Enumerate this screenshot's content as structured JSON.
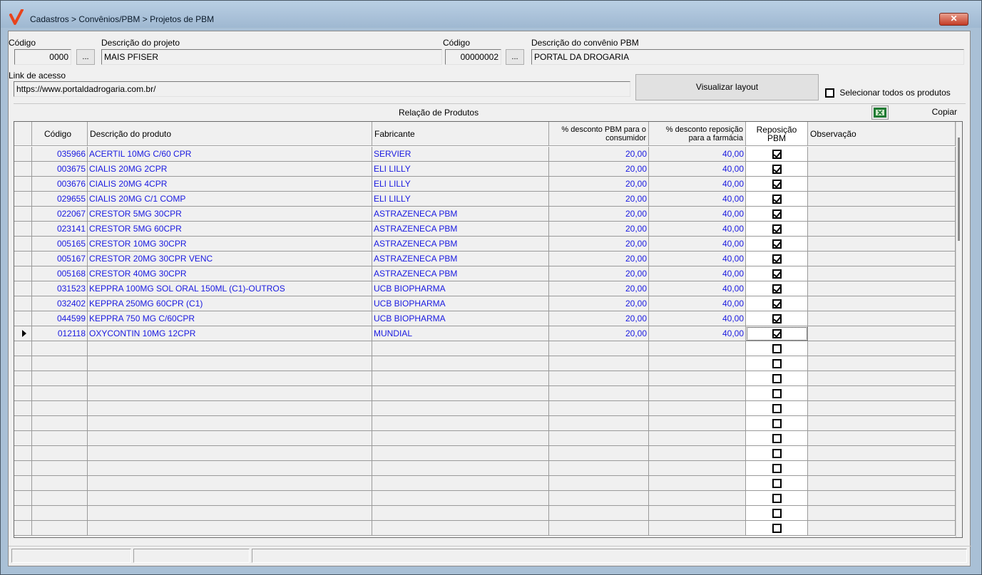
{
  "window": {
    "title": "Cadastros > Convênios/PBM > Projetos de PBM",
    "close_label": "✕"
  },
  "form": {
    "codigo_label": "Código",
    "codigo_value": "0000",
    "descricao_projeto_label": "Descrição do projeto",
    "descricao_projeto_value": "MAIS PFISER",
    "codigo_convenio_label": "Código",
    "codigo_convenio_value": "00000002",
    "descricao_convenio_label": "Descrição do convênio PBM",
    "descricao_convenio_value": "PORTAL DA DROGARIA",
    "ellipsis_label": "...",
    "link_label": "Link de acesso",
    "link_value": "https://www.portaldadrogaria.com.br/",
    "visualizar_layout_label": "Visualizar layout",
    "selecionar_todos_label": "Selecionar todos os produtos",
    "selecionar_todos_checked": false
  },
  "section": {
    "title": "Relação de Produtos",
    "copiar_label": "Copiar",
    "excel_icon": "excel-export-icon"
  },
  "table": {
    "headers": {
      "codigo": "Código",
      "descricao": "Descrição do produto",
      "fabricante": "Fabricante",
      "desconto_pbm": "% desconto PBM para o consumidor",
      "desconto_reposicao": "% desconto reposição para a farmácia",
      "reposicao_pbm": "Reposição PBM",
      "observacao": "Observação"
    },
    "rows": [
      {
        "codigo": "035966",
        "descricao": "ACERTIL 10MG C/60 CPR",
        "fabricante": "SERVIER",
        "desc_pbm": "20,00",
        "desc_rep": "40,00",
        "reposicao": true,
        "obs": ""
      },
      {
        "codigo": "003675",
        "descricao": "CIALIS 20MG 2CPR",
        "fabricante": "ELI LILLY",
        "desc_pbm": "20,00",
        "desc_rep": "40,00",
        "reposicao": true,
        "obs": ""
      },
      {
        "codigo": "003676",
        "descricao": "CIALIS 20MG 4CPR",
        "fabricante": "ELI LILLY",
        "desc_pbm": "20,00",
        "desc_rep": "40,00",
        "reposicao": true,
        "obs": ""
      },
      {
        "codigo": "029655",
        "descricao": "CIALIS 20MG C/1 COMP",
        "fabricante": "ELI LILLY",
        "desc_pbm": "20,00",
        "desc_rep": "40,00",
        "reposicao": true,
        "obs": ""
      },
      {
        "codigo": "022067",
        "descricao": "CRESTOR  5MG 30CPR",
        "fabricante": "ASTRAZENECA PBM",
        "desc_pbm": "20,00",
        "desc_rep": "40,00",
        "reposicao": true,
        "obs": ""
      },
      {
        "codigo": "023141",
        "descricao": "CRESTOR  5MG 60CPR",
        "fabricante": "ASTRAZENECA PBM",
        "desc_pbm": "20,00",
        "desc_rep": "40,00",
        "reposicao": true,
        "obs": ""
      },
      {
        "codigo": "005165",
        "descricao": "CRESTOR 10MG 30CPR",
        "fabricante": "ASTRAZENECA PBM",
        "desc_pbm": "20,00",
        "desc_rep": "40,00",
        "reposicao": true,
        "obs": ""
      },
      {
        "codigo": "005167",
        "descricao": "CRESTOR 20MG 30CPR VENC",
        "fabricante": "ASTRAZENECA PBM",
        "desc_pbm": "20,00",
        "desc_rep": "40,00",
        "reposicao": true,
        "obs": ""
      },
      {
        "codigo": "005168",
        "descricao": "CRESTOR 40MG 30CPR",
        "fabricante": "ASTRAZENECA PBM",
        "desc_pbm": "20,00",
        "desc_rep": "40,00",
        "reposicao": true,
        "obs": ""
      },
      {
        "codigo": "031523",
        "descricao": "KEPPRA 100MG SOL ORAL 150ML (C1)-OUTROS",
        "fabricante": "UCB BIOPHARMA",
        "desc_pbm": "20,00",
        "desc_rep": "40,00",
        "reposicao": true,
        "obs": ""
      },
      {
        "codigo": "032402",
        "descricao": "KEPPRA 250MG 60CPR (C1)",
        "fabricante": "UCB BIOPHARMA",
        "desc_pbm": "20,00",
        "desc_rep": "40,00",
        "reposicao": true,
        "obs": ""
      },
      {
        "codigo": "044599",
        "descricao": "KEPPRA 750 MG C/60CPR",
        "fabricante": "UCB BIOPHARMA",
        "desc_pbm": "20,00",
        "desc_rep": "40,00",
        "reposicao": true,
        "obs": ""
      },
      {
        "codigo": "012118",
        "descricao": "OXYCONTIN 10MG  12CPR",
        "fabricante": "MUNDIAL",
        "desc_pbm": "20,00",
        "desc_rep": "40,00",
        "reposicao": true,
        "obs": "",
        "current": true
      },
      {
        "codigo": "",
        "descricao": "",
        "fabricante": "",
        "desc_pbm": "",
        "desc_rep": "",
        "reposicao": false,
        "obs": ""
      },
      {
        "codigo": "",
        "descricao": "",
        "fabricante": "",
        "desc_pbm": "",
        "desc_rep": "",
        "reposicao": false,
        "obs": ""
      },
      {
        "codigo": "",
        "descricao": "",
        "fabricante": "",
        "desc_pbm": "",
        "desc_rep": "",
        "reposicao": false,
        "obs": ""
      },
      {
        "codigo": "",
        "descricao": "",
        "fabricante": "",
        "desc_pbm": "",
        "desc_rep": "",
        "reposicao": false,
        "obs": ""
      },
      {
        "codigo": "",
        "descricao": "",
        "fabricante": "",
        "desc_pbm": "",
        "desc_rep": "",
        "reposicao": false,
        "obs": ""
      },
      {
        "codigo": "",
        "descricao": "",
        "fabricante": "",
        "desc_pbm": "",
        "desc_rep": "",
        "reposicao": false,
        "obs": ""
      },
      {
        "codigo": "",
        "descricao": "",
        "fabricante": "",
        "desc_pbm": "",
        "desc_rep": "",
        "reposicao": false,
        "obs": ""
      },
      {
        "codigo": "",
        "descricao": "",
        "fabricante": "",
        "desc_pbm": "",
        "desc_rep": "",
        "reposicao": false,
        "obs": ""
      },
      {
        "codigo": "",
        "descricao": "",
        "fabricante": "",
        "desc_pbm": "",
        "desc_rep": "",
        "reposicao": false,
        "obs": ""
      },
      {
        "codigo": "",
        "descricao": "",
        "fabricante": "",
        "desc_pbm": "",
        "desc_rep": "",
        "reposicao": false,
        "obs": ""
      },
      {
        "codigo": "",
        "descricao": "",
        "fabricante": "",
        "desc_pbm": "",
        "desc_rep": "",
        "reposicao": false,
        "obs": ""
      },
      {
        "codigo": "",
        "descricao": "",
        "fabricante": "",
        "desc_pbm": "",
        "desc_rep": "",
        "reposicao": false,
        "obs": ""
      },
      {
        "codigo": "",
        "descricao": "",
        "fabricante": "",
        "desc_pbm": "",
        "desc_rep": "",
        "reposicao": false,
        "obs": ""
      }
    ]
  },
  "colors": {
    "window_frame": "#a9c0d6",
    "data_text": "#1a1ae0",
    "client_bg": "#f0f0f0",
    "logo_red": "#e8431c"
  }
}
